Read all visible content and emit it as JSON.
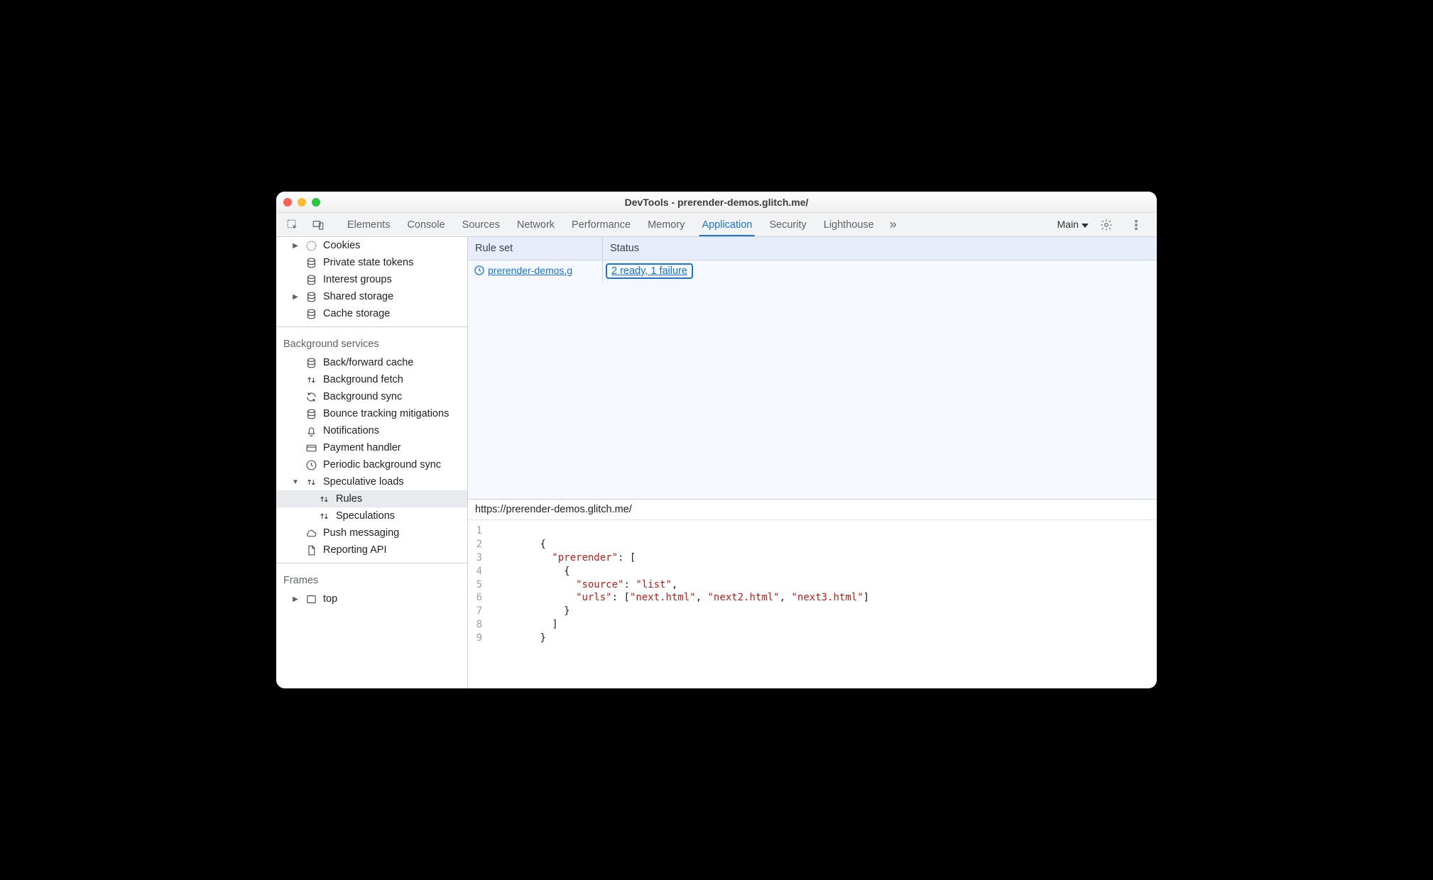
{
  "window": {
    "title": "DevTools - prerender-demos.glitch.me/"
  },
  "toolbar": {
    "tabs": [
      "Elements",
      "Console",
      "Sources",
      "Network",
      "Performance",
      "Memory",
      "Application",
      "Security",
      "Lighthouse"
    ],
    "activeTab": "Application",
    "target": "Main"
  },
  "sidebar": {
    "storage": [
      {
        "label": "Cookies",
        "icon": "cookie",
        "arrow": "right"
      },
      {
        "label": "Private state tokens",
        "icon": "db",
        "arrow": "none"
      },
      {
        "label": "Interest groups",
        "icon": "db",
        "arrow": "none"
      },
      {
        "label": "Shared storage",
        "icon": "db",
        "arrow": "right"
      },
      {
        "label": "Cache storage",
        "icon": "db",
        "arrow": "none"
      }
    ],
    "bgTitle": "Background services",
    "bg": [
      {
        "label": "Back/forward cache",
        "icon": "db"
      },
      {
        "label": "Background fetch",
        "icon": "updown"
      },
      {
        "label": "Background sync",
        "icon": "sync"
      },
      {
        "label": "Bounce tracking mitigations",
        "icon": "db"
      },
      {
        "label": "Notifications",
        "icon": "bell"
      },
      {
        "label": "Payment handler",
        "icon": "card"
      },
      {
        "label": "Periodic background sync",
        "icon": "clock"
      }
    ],
    "spec": {
      "label": "Speculative loads",
      "icon": "updown",
      "children": [
        {
          "label": "Rules",
          "icon": "updown",
          "selected": true
        },
        {
          "label": "Speculations",
          "icon": "updown"
        }
      ]
    },
    "bg2": [
      {
        "label": "Push messaging",
        "icon": "cloud"
      },
      {
        "label": "Reporting API",
        "icon": "file"
      }
    ],
    "framesTitle": "Frames",
    "frames": [
      {
        "label": "top",
        "icon": "frame",
        "arrow": "right"
      }
    ]
  },
  "grid": {
    "headers": {
      "ruleset": "Rule set",
      "status": "Status"
    },
    "row": {
      "ruleset": "prerender-demos.g",
      "status": "2 ready, 1 failure"
    }
  },
  "source": {
    "url": "https://prerender-demos.glitch.me/",
    "code": {
      "key_prerender": "\"prerender\"",
      "key_source": "\"source\"",
      "val_source": "\"list\"",
      "key_urls": "\"urls\"",
      "urls": [
        "\"next.html\"",
        "\"next2.html\"",
        "\"next3.html\""
      ]
    }
  }
}
